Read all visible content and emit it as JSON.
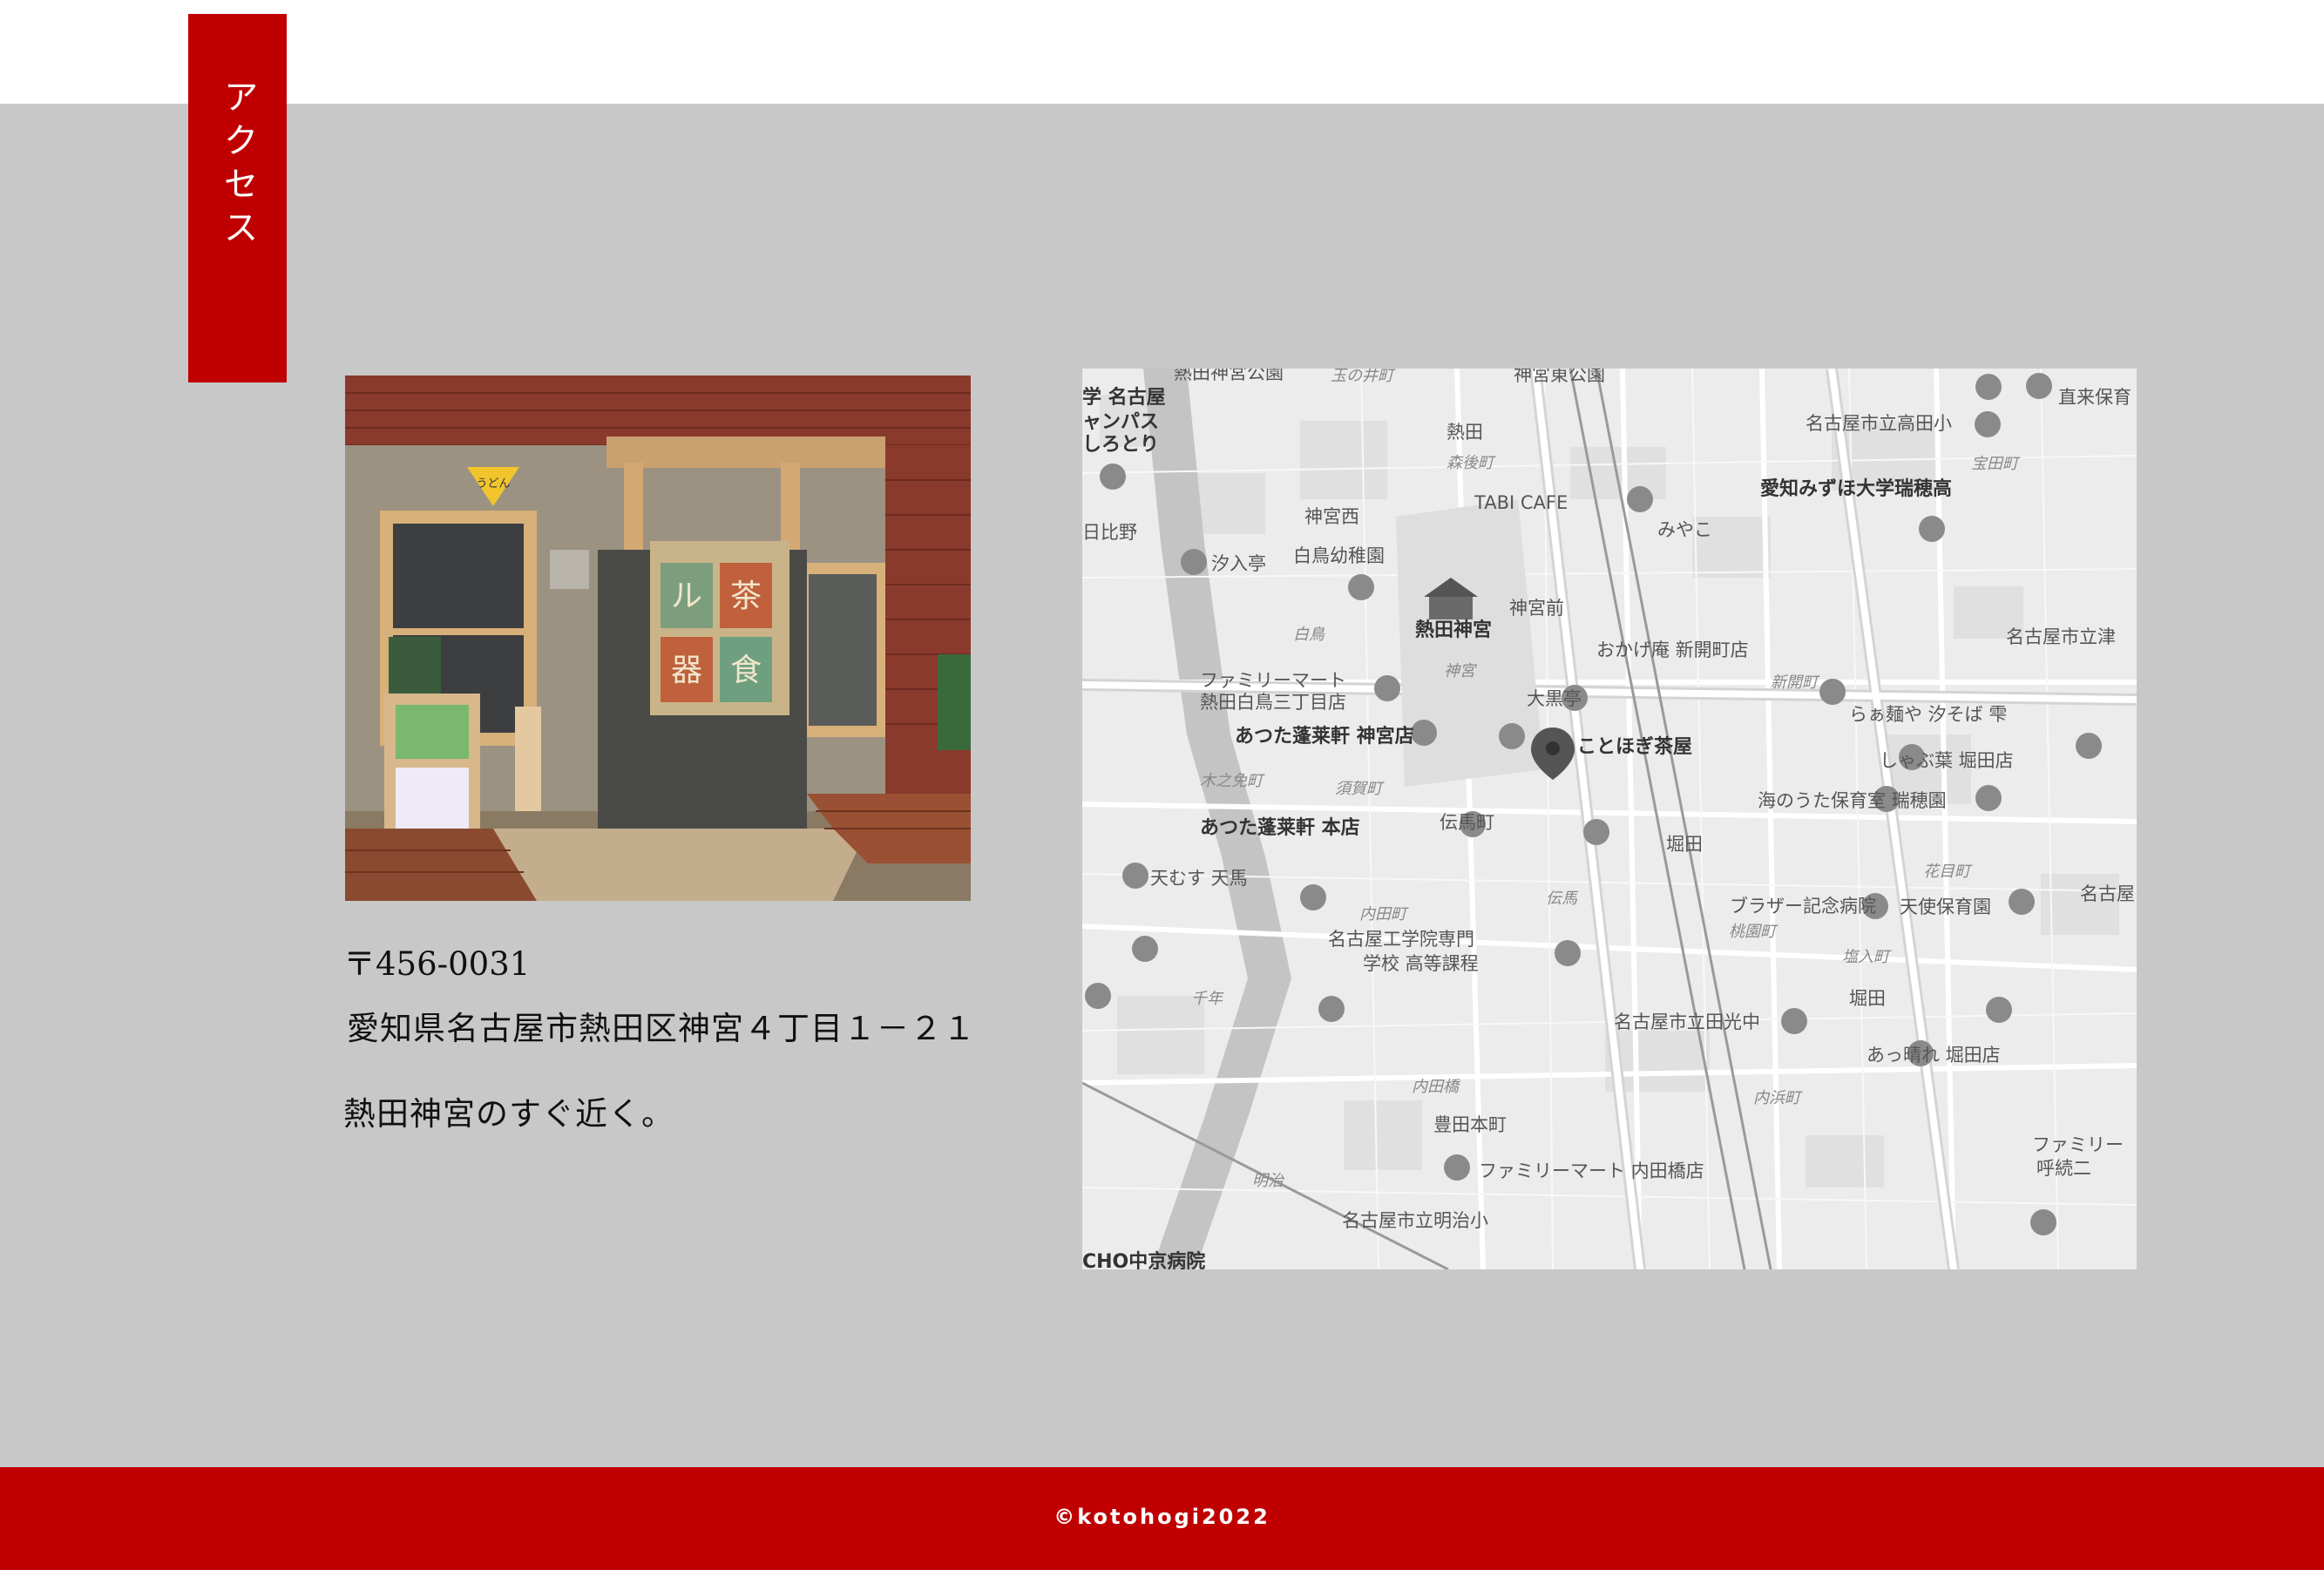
{
  "section": {
    "title": "アクセス"
  },
  "access": {
    "postal": "〒456-0031",
    "address": "愛知県名古屋市熱田区神宮４丁目１－２１",
    "note": "熱田神宮のすぐ近く。"
  },
  "photo": {
    "noren_chars": [
      "ル",
      "茶",
      "器",
      "食"
    ],
    "flag_text": "うどん"
  },
  "map": {
    "labels": {
      "atsuta_park": "熱田神宮公園",
      "tamanoi": "玉の井町",
      "jingu_east_park": "神宮東公園",
      "school_top": "学 名古屋",
      "campus": "ャンパス",
      "shiratori": "しろとり",
      "atsuta_station": "熱田",
      "morigo": "森後町",
      "tabi_cafe": "TABI CAFE",
      "miyako": "みやこ",
      "jinguu_nishi": "神宮西",
      "hibino": "日比野",
      "shioiritei": "汐入亭",
      "shiratori_kinder": "白鳥幼稚園",
      "atsuta_jingu": "熱田神宮",
      "jingumae": "神宮前",
      "shiratori_area": "白鳥",
      "okageya": "おかげ庵 新開町店",
      "family_mart": "ファミリーマート",
      "family_mart_branch": "熱田白鳥三丁目店",
      "jingu_area": "神宮",
      "daikokutei": "大黒亭",
      "horaiken_jingu": "あつた蓬莱軒 神宮店",
      "kotohogi": "ことほぎ茶屋",
      "kinoko": "木之免町",
      "sudacho": "須賀町",
      "horaiken_honten": "あつた蓬莱軒 本店",
      "tenmacho": "伝馬町",
      "tenmusu": "天むす 天馬",
      "uchidacho": "内田町",
      "denma": "伝馬",
      "nit": "名古屋工学院専門",
      "nit2": "学校 高等課程",
      "chitose": "千年",
      "uchidabashi": "内田橋",
      "toyoda": "豊田本町",
      "family_mart_uchida": "ファミリーマート 内田橋店",
      "meiji": "明治",
      "meiji_school": "名古屋市立明治小",
      "chukyo": "CHO中京病院",
      "takada": "名古屋市立高田小",
      "mizuho_univ": "愛知みずほ大学瑞穂高",
      "hotaru": "宝田町",
      "tsu": "名古屋市立津",
      "shinkai": "新開町",
      "ramen": "らぁ麺や 汐そば 雫",
      "shabu": "しゃぶ葉 堀田店",
      "uta": "海のうた保育室 瑞穂園",
      "horita_sta": "堀田",
      "brother": "ブラザー記念病院",
      "tenshi": "天使保育園",
      "tamachi": "塩入町",
      "horita2": "堀田",
      "tanko": "名古屋市立田光中",
      "appare": "あっ晴れ 堀田店",
      "uchihama": "内浜町",
      "momomachi": "桃園町",
      "hanamecho": "花目町",
      "family_mart_right": "ファミリー",
      "yobitsugi": "呼続二",
      "naka": "直来保育",
      "nagoya_right": "名古屋"
    }
  },
  "footer": {
    "copyright": "©kotohogi2022"
  }
}
